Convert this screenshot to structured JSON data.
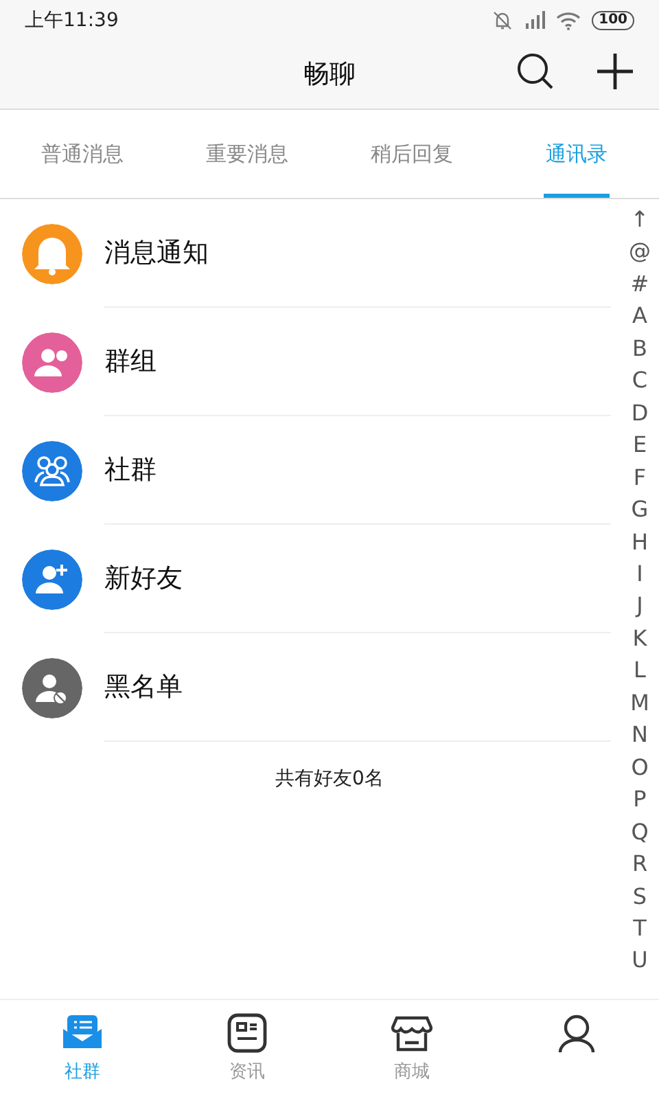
{
  "status_bar": {
    "time": "上午11:39",
    "battery": "100"
  },
  "header": {
    "title": "畅聊"
  },
  "tabs": [
    {
      "label": "普通消息",
      "selected": false
    },
    {
      "label": "重要消息",
      "selected": false
    },
    {
      "label": "稍后回复",
      "selected": false
    },
    {
      "label": "通讯录",
      "selected": true
    }
  ],
  "contacts_menu": [
    {
      "label": "消息通知",
      "kind": "bell",
      "color": "#f7941d"
    },
    {
      "label": "群组",
      "kind": "group",
      "color": "#e3609a"
    },
    {
      "label": "社群",
      "kind": "community",
      "color": "#1d7ce0"
    },
    {
      "label": "新好友",
      "kind": "add-friend",
      "color": "#1d7ce0"
    },
    {
      "label": "黑名单",
      "kind": "blocked",
      "color": "#666666"
    }
  ],
  "friend_count": "共有好友0名",
  "index_letters": [
    "↑",
    "@",
    "#",
    "A",
    "B",
    "C",
    "D",
    "E",
    "F",
    "G",
    "H",
    "I",
    "J",
    "K",
    "L",
    "M",
    "N",
    "O",
    "P",
    "Q",
    "R",
    "S",
    "T",
    "U"
  ],
  "bottom_nav": [
    {
      "label": "社群",
      "kind": "community",
      "selected": true
    },
    {
      "label": "资讯",
      "kind": "news",
      "selected": false
    },
    {
      "label": "商城",
      "kind": "shop",
      "selected": false
    },
    {
      "kind": "profile",
      "selected": false
    }
  ]
}
